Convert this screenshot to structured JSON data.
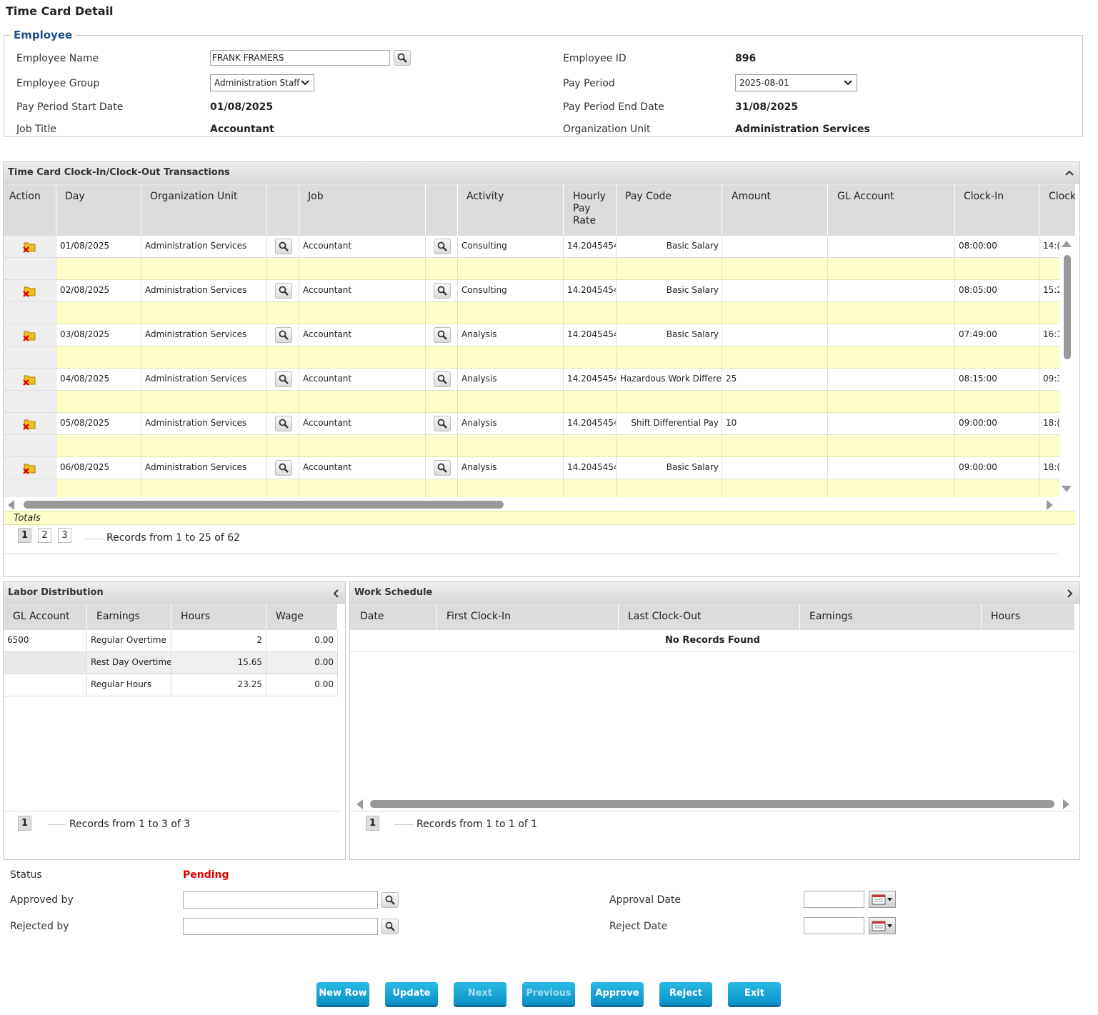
{
  "page": {
    "title": "Time Card Detail"
  },
  "employee": {
    "legend": "Employee",
    "name_label": "Employee Name",
    "name_value": "FRANK FRAMERS",
    "id_label": "Employee ID",
    "id_value": "896",
    "group_label": "Employee Group",
    "group_value": "Administration Staff",
    "pay_period_label": "Pay Period",
    "pay_period_value": "2025-08-01",
    "start_label": "Pay Period Start Date",
    "start_value": "01/08/2025",
    "end_label": "Pay Period End Date",
    "end_value": "31/08/2025",
    "job_label": "Job Title",
    "job_value": "Accountant",
    "org_label": "Organization Unit",
    "org_value": "Administration Services"
  },
  "transactions": {
    "title": "Time Card Clock-In/Clock-Out Transactions",
    "columns": {
      "action": "Action",
      "day": "Day",
      "org": "Organization Unit",
      "job": "Job",
      "activity": "Activity",
      "rate_line1": "Hourly",
      "rate_line2": "Pay Rate",
      "paycode": "Pay Code",
      "amount": "Amount",
      "gl": "GL Account",
      "clockin": "Clock-In",
      "clockout": "Clock-"
    },
    "rows": [
      {
        "day": "01/08/2025",
        "org": "Administration Services",
        "job": "Accountant",
        "activity": "Consulting",
        "rate": "14.2045454",
        "paycode": "Basic Salary",
        "amount": "",
        "gl": "",
        "clockin": "08:00:00",
        "clockout": "14:("
      },
      {
        "day": "02/08/2025",
        "org": "Administration Services",
        "job": "Accountant",
        "activity": "Consulting",
        "rate": "14.2045454",
        "paycode": "Basic Salary",
        "amount": "",
        "gl": "",
        "clockin": "08:05:00",
        "clockout": "15:2"
      },
      {
        "day": "03/08/2025",
        "org": "Administration Services",
        "job": "Accountant",
        "activity": "Analysis",
        "rate": "14.2045454",
        "paycode": "Basic Salary",
        "amount": "",
        "gl": "",
        "clockin": "07:49:00",
        "clockout": "16:1"
      },
      {
        "day": "04/08/2025",
        "org": "Administration Services",
        "job": "Accountant",
        "activity": "Analysis",
        "rate": "14.2045454",
        "paycode": "Hazardous Work Differer",
        "amount": "25",
        "gl": "",
        "clockin": "08:15:00",
        "clockout": "09:3"
      },
      {
        "day": "05/08/2025",
        "org": "Administration Services",
        "job": "Accountant",
        "activity": "Analysis",
        "rate": "14.2045454",
        "paycode": "Shift Differential Pay",
        "amount": "10",
        "gl": "",
        "clockin": "09:00:00",
        "clockout": "18:("
      },
      {
        "day": "06/08/2025",
        "org": "Administration Services",
        "job": "Accountant",
        "activity": "Analysis",
        "rate": "14.2045454",
        "paycode": "Basic Salary",
        "amount": "",
        "gl": "",
        "clockin": "09:00:00",
        "clockout": "18:("
      }
    ],
    "totals_label": "Totals",
    "pages": [
      "1",
      "2",
      "3"
    ],
    "records_text": "Records from 1 to 25 of 62"
  },
  "labor": {
    "title": "Labor Distribution",
    "columns": {
      "gl": "GL Account",
      "earnings": "Earnings",
      "hours": "Hours",
      "wage": "Wage"
    },
    "rows": [
      {
        "gl": "6500",
        "earnings": "Regular Overtime",
        "hours": "2",
        "wage": "0.00"
      },
      {
        "gl": "",
        "earnings": "Rest Day Overtime",
        "hours": "15.65",
        "wage": "0.00"
      },
      {
        "gl": "",
        "earnings": "Regular Hours",
        "hours": "23.25",
        "wage": "0.00"
      }
    ],
    "pages": [
      "1"
    ],
    "records_text": "Records from 1 to 3 of 3"
  },
  "schedule": {
    "title": "Work Schedule",
    "columns": {
      "date": "Date",
      "first": "First Clock-In",
      "last": "Last Clock-Out",
      "earnings": "Earnings",
      "hours": "Hours"
    },
    "empty_text": "No Records Found",
    "pages": [
      "1"
    ],
    "records_text": "Records from 1 to 1 of 1"
  },
  "approval": {
    "status_label": "Status",
    "status_value": "Pending",
    "status_color": "#e00000",
    "approved_by_label": "Approved by",
    "approved_by_value": "",
    "rejected_by_label": "Rejected by",
    "rejected_by_value": "",
    "approval_date_label": "Approval Date",
    "approval_date_value": "",
    "reject_date_label": "Reject Date",
    "reject_date_value": ""
  },
  "buttons": {
    "new_row": "New Row",
    "update": "Update",
    "next": "Next",
    "previous": "Previous",
    "approve": "Approve",
    "reject": "Reject",
    "exit": "Exit"
  },
  "colors": {
    "accent": "#1ba7d9",
    "totals_bg": "#ffffc8",
    "legend": "#1f4e8c"
  }
}
